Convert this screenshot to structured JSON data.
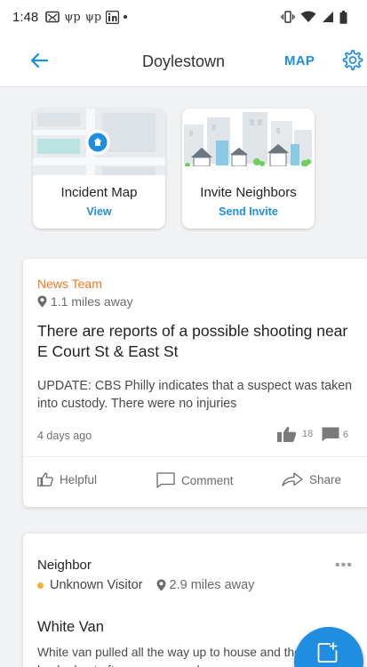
{
  "status_bar": {
    "time": "1:48",
    "left_icons": [
      "mail-icon",
      "app-icon",
      "app-icon",
      "linkedin-icon",
      "dot-icon"
    ],
    "right_icons": [
      "vibrate-icon",
      "wifi-icon",
      "signal-icon",
      "battery-icon"
    ],
    "app_icon_text": "ψp"
  },
  "app_bar": {
    "back_icon": "arrow-left-icon",
    "title": "Doylestown",
    "map_label": "MAP",
    "settings_icon": "gear-icon"
  },
  "tiles": [
    {
      "title": "Incident Map",
      "action": "View"
    },
    {
      "title": "Invite Neighbors",
      "action": "Send Invite"
    }
  ],
  "posts": [
    {
      "source": "News Team",
      "distance": "1.1 miles away",
      "title": "There are reports of a possible shooting near E Court St & East St",
      "body": "UPDATE: CBS Philly indicates that a suspect was taken into custody. There were no injuries",
      "time": "4 days ago",
      "likes": "18",
      "comments": "6",
      "actions": {
        "helpful": "Helpful",
        "comment": "Comment",
        "share": "Share"
      }
    },
    {
      "source": "Neighbor",
      "category": "Unknown Visitor",
      "distance": "2.9 miles away",
      "title": "White Van",
      "body": "White van pulled all the way up to house and then backed out after my son saw h"
    }
  ],
  "colors": {
    "accent": "#1f8de0",
    "news": "#f47820",
    "category_dot": "#f5b02c"
  }
}
